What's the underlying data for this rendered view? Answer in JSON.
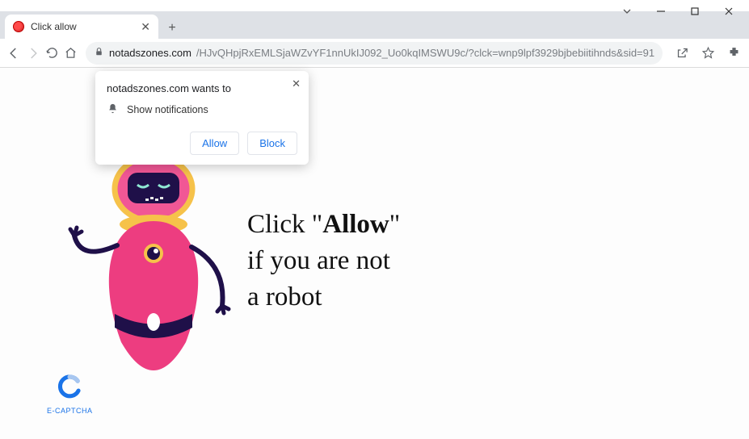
{
  "tab": {
    "title": "Click allow"
  },
  "addressbar": {
    "domain": "notadszones.com",
    "path": "/HJvQHpjRxEMLSjaWZvYF1nnUkIJ092_Uo0kqIMSWU9c/?clck=wnp9lpf3929bjbebiitihnds&sid=91"
  },
  "notification": {
    "origin_line": "notadszones.com wants to",
    "permission_label": "Show notifications",
    "allow_label": "Allow",
    "block_label": "Block"
  },
  "page_text": {
    "line1_pre": "Click \"",
    "line1_bold": "Allow",
    "line1_post": "\"",
    "line2": "if you are not",
    "line3": "a robot"
  },
  "captcha": {
    "label": "E-CAPTCHA"
  },
  "colors": {
    "robot_pink": "#ed3d80",
    "robot_pink_light": "#f15795",
    "robot_accent_yellow": "#f6c24a",
    "robot_dark": "#1f1049",
    "link_blue": "#1a73e8"
  }
}
